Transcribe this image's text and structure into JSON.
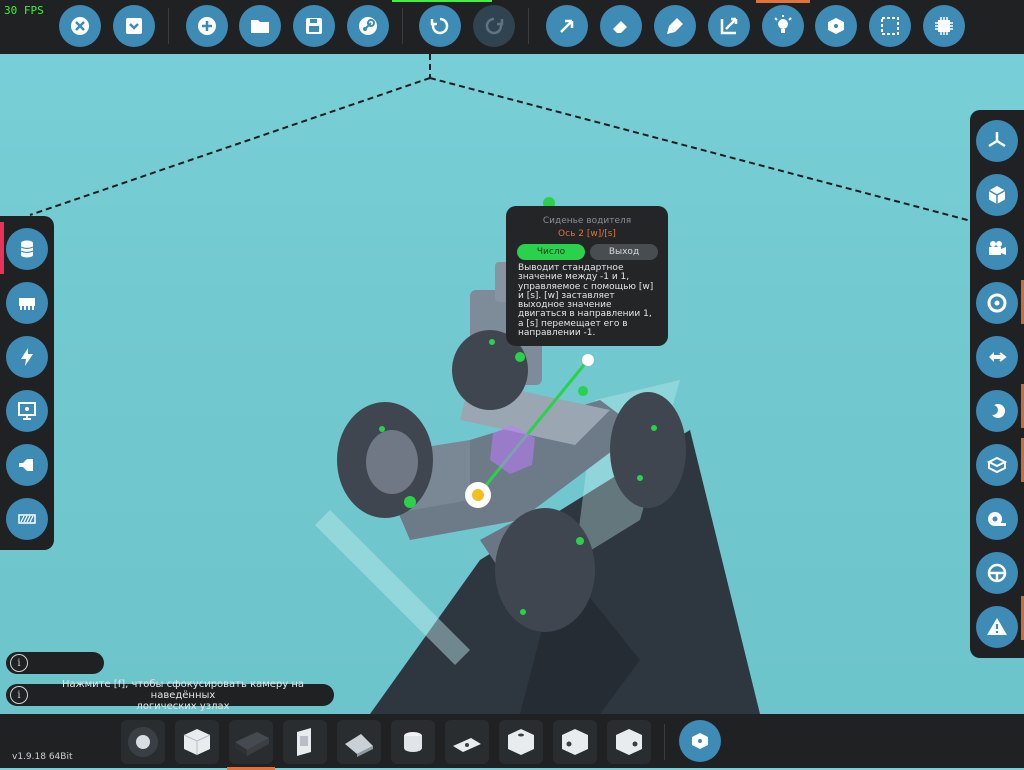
{
  "fps": "30 FPS",
  "version": "v1.9.18 64Bit",
  "toolbar": {
    "buttons": [
      "close-icon",
      "hide-ui-icon",
      "new-icon",
      "open-folder-icon",
      "save-icon",
      "steam-icon",
      "undo-icon",
      "redo-icon",
      "select-pointer-icon",
      "eraser-icon",
      "paint-icon",
      "transform-icon",
      "light-icon",
      "logic-icon",
      "select-area-icon",
      "microchip-icon"
    ]
  },
  "left_panel": {
    "buttons": [
      "block-inventory-icon",
      "mechanical-icon",
      "electric-icon",
      "display-icon",
      "signal-icon",
      "decal-icon"
    ]
  },
  "right_panel": {
    "buttons": [
      "view-axis-icon",
      "view-cube-icon",
      "camera-icon",
      "target-icon",
      "transfer-icon",
      "moon-icon",
      "block-outline-icon",
      "measure-tape-icon",
      "steering-wheel-icon",
      "warning-icon"
    ]
  },
  "tooltip": {
    "title": "Сиденье водителя",
    "subtitle": "Ось 2 [w]/[s]",
    "tab_number": "Число",
    "tab_output": "Выход",
    "description": "Выводит стандартное значение между -1 и 1, управляемое с помощью [w] и [s]. [w] заставляет выходное значение двигаться в направлении 1, а [s] перемещает его в направлении -1."
  },
  "info": {
    "icon": "i",
    "hint_line1": "Нажмите [f], чтобы сфокусировать камеру на наведённых",
    "hint_line2": "логических узлах"
  },
  "hotbar": {
    "slots": [
      "wheel-block",
      "cube-block",
      "battery-block",
      "panel-block",
      "wedge-block",
      "cylinder-block",
      "pipe-block",
      "cube-hole-block",
      "cube-hole-block-2",
      "cube-hole-block-3"
    ],
    "logic_button": "logic-icon"
  },
  "colors": {
    "panel": "#1f2123",
    "button": "#3e8bb6",
    "accent": "#e0733b",
    "active_green": "#2ad14b",
    "sky": "#72c9cf"
  }
}
